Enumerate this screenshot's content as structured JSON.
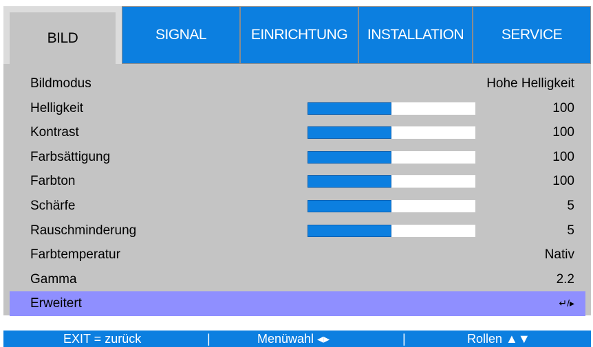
{
  "tabs": [
    {
      "label": "BILD",
      "active": true
    },
    {
      "label": "SIGNAL",
      "active": false
    },
    {
      "label": "EINRICHTUNG",
      "active": false
    },
    {
      "label": "INSTALLATION",
      "active": false
    },
    {
      "label": "SERVICE",
      "active": false
    }
  ],
  "menu": {
    "bildmodus": {
      "label": "Bildmodus",
      "value": "Hohe Helligkeit"
    },
    "helligkeit": {
      "label": "Helligkeit",
      "value": "100",
      "level": 0.5
    },
    "kontrast": {
      "label": "Kontrast",
      "value": "100",
      "level": 0.5
    },
    "farbsaettigung": {
      "label": "Farbsättigung",
      "value": "100",
      "level": 0.5
    },
    "farbton": {
      "label": "Farbton",
      "value": "100",
      "level": 0.5
    },
    "schaerfe": {
      "label": "Schärfe",
      "value": "5",
      "level": 0.5
    },
    "rauschminderung": {
      "label": "Rauschminderung",
      "value": "5",
      "level": 0.5
    },
    "farbtemperatur": {
      "label": "Farbtemperatur",
      "value": "Nativ"
    },
    "gamma": {
      "label": "Gamma",
      "value": "2.2"
    },
    "erweitert": {
      "label": "Erweitert",
      "value": "↵/▸",
      "selected": true
    }
  },
  "footer": {
    "exit": "EXIT = zurück",
    "sep1": "|",
    "menuwahl": "Menüwahl ◂▸",
    "sep2": "|",
    "rollen": "Rollen ▲▼"
  },
  "colors": {
    "tab_blue": "#0c7fe0",
    "panel_gray": "#c4c4c4",
    "selected_row": "#8f8fff",
    "slider_fill": "#0c7fe0"
  }
}
